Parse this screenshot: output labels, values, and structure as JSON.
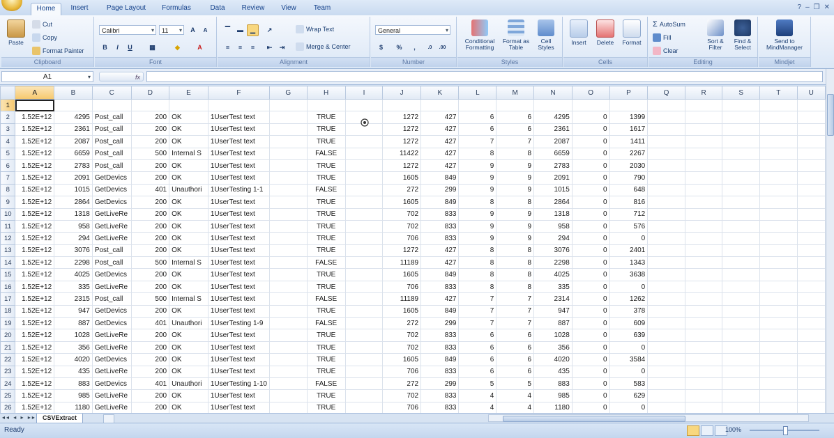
{
  "ribbon": {
    "tabs": [
      "Home",
      "Insert",
      "Page Layout",
      "Formulas",
      "Data",
      "Review",
      "View",
      "Team"
    ],
    "active_tab": "Home",
    "clipboard": {
      "paste": "Paste",
      "cut": "Cut",
      "copy": "Copy",
      "format_painter": "Format Painter",
      "label": "Clipboard"
    },
    "font": {
      "name": "Calibri",
      "size": "11",
      "bold": "B",
      "italic": "I",
      "underline": "U",
      "label": "Font"
    },
    "alignment": {
      "wrap_text": "Wrap Text",
      "merge_center": "Merge & Center",
      "label": "Alignment"
    },
    "number": {
      "format": "General",
      "currency": "$",
      "percent": "%",
      "comma": ",",
      "label": "Number"
    },
    "styles": {
      "conditional": "Conditional Formatting",
      "format_table": "Format as Table",
      "cell_styles": "Cell Styles",
      "label": "Styles"
    },
    "cells": {
      "insert": "Insert",
      "delete": "Delete",
      "format": "Format",
      "label": "Cells"
    },
    "editing": {
      "autosum": "AutoSum",
      "fill": "Fill",
      "clear": "Clear",
      "sort_filter": "Sort & Filter",
      "find_select": "Find & Select",
      "label": "Editing"
    },
    "mindjet": {
      "send": "Send to MindManager",
      "label": "Mindjet"
    }
  },
  "formula_bar": {
    "name_box": "A1",
    "fx": "fx",
    "value": ""
  },
  "grid": {
    "columns": [
      "A",
      "B",
      "C",
      "D",
      "E",
      "F",
      "G",
      "H",
      "I",
      "J",
      "K",
      "L",
      "M",
      "N",
      "O",
      "P",
      "Q",
      "R",
      "S",
      "T",
      "U"
    ],
    "rows": [
      {
        "n": "1",
        "c": [
          "",
          "",
          "",
          "",
          "",
          "",
          "",
          "",
          "",
          "",
          "",
          "",
          "",
          "",
          "",
          ""
        ]
      },
      {
        "n": "2",
        "c": [
          "1.52E+12",
          "4295",
          "Post_call",
          "200",
          "OK",
          "1UserTest text",
          "",
          "TRUE",
          "",
          "1272",
          "427",
          "6",
          "6",
          "4295",
          "0",
          "1399"
        ]
      },
      {
        "n": "3",
        "c": [
          "1.52E+12",
          "2361",
          "Post_call",
          "200",
          "OK",
          "1UserTest text",
          "",
          "TRUE",
          "",
          "1272",
          "427",
          "6",
          "6",
          "2361",
          "0",
          "1617"
        ]
      },
      {
        "n": "4",
        "c": [
          "1.52E+12",
          "2087",
          "Post_call",
          "200",
          "OK",
          "1UserTest text",
          "",
          "TRUE",
          "",
          "1272",
          "427",
          "7",
          "7",
          "2087",
          "0",
          "1411"
        ]
      },
      {
        "n": "5",
        "c": [
          "1.52E+12",
          "6659",
          "Post_call",
          "500",
          "Internal S",
          "1UserTest text",
          "",
          "FALSE",
          "",
          "11422",
          "427",
          "8",
          "8",
          "6659",
          "0",
          "2267"
        ]
      },
      {
        "n": "6",
        "c": [
          "1.52E+12",
          "2783",
          "Post_call",
          "200",
          "OK",
          "1UserTest text",
          "",
          "TRUE",
          "",
          "1272",
          "427",
          "9",
          "9",
          "2783",
          "0",
          "2030"
        ]
      },
      {
        "n": "7",
        "c": [
          "1.52E+12",
          "2091",
          "GetDevics",
          "200",
          "OK",
          "1UserTest text",
          "",
          "TRUE",
          "",
          "1605",
          "849",
          "9",
          "9",
          "2091",
          "0",
          "790"
        ]
      },
      {
        "n": "8",
        "c": [
          "1.52E+12",
          "1015",
          "GetDevics",
          "401",
          "Unauthori",
          "1UserTesting 1-1",
          "",
          "FALSE",
          "",
          "272",
          "299",
          "9",
          "9",
          "1015",
          "0",
          "648"
        ]
      },
      {
        "n": "9",
        "c": [
          "1.52E+12",
          "2864",
          "GetDevics",
          "200",
          "OK",
          "1UserTest text",
          "",
          "TRUE",
          "",
          "1605",
          "849",
          "8",
          "8",
          "2864",
          "0",
          "816"
        ]
      },
      {
        "n": "10",
        "c": [
          "1.52E+12",
          "1318",
          "GetLiveRe",
          "200",
          "OK",
          "1UserTest text",
          "",
          "TRUE",
          "",
          "702",
          "833",
          "9",
          "9",
          "1318",
          "0",
          "712"
        ]
      },
      {
        "n": "11",
        "c": [
          "1.52E+12",
          "958",
          "GetLiveRe",
          "200",
          "OK",
          "1UserTest text",
          "",
          "TRUE",
          "",
          "702",
          "833",
          "9",
          "9",
          "958",
          "0",
          "576"
        ]
      },
      {
        "n": "12",
        "c": [
          "1.52E+12",
          "294",
          "GetLiveRe",
          "200",
          "OK",
          "1UserTest text",
          "",
          "TRUE",
          "",
          "706",
          "833",
          "9",
          "9",
          "294",
          "0",
          "0"
        ]
      },
      {
        "n": "13",
        "c": [
          "1.52E+12",
          "3076",
          "Post_call",
          "200",
          "OK",
          "1UserTest text",
          "",
          "TRUE",
          "",
          "1272",
          "427",
          "8",
          "8",
          "3076",
          "0",
          "2401"
        ]
      },
      {
        "n": "14",
        "c": [
          "1.52E+12",
          "2298",
          "Post_call",
          "500",
          "Internal S",
          "1UserTest text",
          "",
          "FALSE",
          "",
          "11189",
          "427",
          "8",
          "8",
          "2298",
          "0",
          "1343"
        ]
      },
      {
        "n": "15",
        "c": [
          "1.52E+12",
          "4025",
          "GetDevics",
          "200",
          "OK",
          "1UserTest text",
          "",
          "TRUE",
          "",
          "1605",
          "849",
          "8",
          "8",
          "4025",
          "0",
          "3638"
        ]
      },
      {
        "n": "16",
        "c": [
          "1.52E+12",
          "335",
          "GetLiveRe",
          "200",
          "OK",
          "1UserTest text",
          "",
          "TRUE",
          "",
          "706",
          "833",
          "8",
          "8",
          "335",
          "0",
          "0"
        ]
      },
      {
        "n": "17",
        "c": [
          "1.52E+12",
          "2315",
          "Post_call",
          "500",
          "Internal S",
          "1UserTest text",
          "",
          "FALSE",
          "",
          "11189",
          "427",
          "7",
          "7",
          "2314",
          "0",
          "1262"
        ]
      },
      {
        "n": "18",
        "c": [
          "1.52E+12",
          "947",
          "GetDevics",
          "200",
          "OK",
          "1UserTest text",
          "",
          "TRUE",
          "",
          "1605",
          "849",
          "7",
          "7",
          "947",
          "0",
          "378"
        ]
      },
      {
        "n": "19",
        "c": [
          "1.52E+12",
          "887",
          "GetDevics",
          "401",
          "Unauthori",
          "1UserTesting 1-9",
          "",
          "FALSE",
          "",
          "272",
          "299",
          "7",
          "7",
          "887",
          "0",
          "609"
        ]
      },
      {
        "n": "20",
        "c": [
          "1.52E+12",
          "1028",
          "GetLiveRe",
          "200",
          "OK",
          "1UserTest text",
          "",
          "TRUE",
          "",
          "702",
          "833",
          "6",
          "6",
          "1028",
          "0",
          "639"
        ]
      },
      {
        "n": "21",
        "c": [
          "1.52E+12",
          "356",
          "GetLiveRe",
          "200",
          "OK",
          "1UserTest text",
          "",
          "TRUE",
          "",
          "702",
          "833",
          "6",
          "6",
          "356",
          "0",
          "0"
        ]
      },
      {
        "n": "22",
        "c": [
          "1.52E+12",
          "4020",
          "GetDevics",
          "200",
          "OK",
          "1UserTest text",
          "",
          "TRUE",
          "",
          "1605",
          "849",
          "6",
          "6",
          "4020",
          "0",
          "3584"
        ]
      },
      {
        "n": "23",
        "c": [
          "1.52E+12",
          "435",
          "GetLiveRe",
          "200",
          "OK",
          "1UserTest text",
          "",
          "TRUE",
          "",
          "706",
          "833",
          "6",
          "6",
          "435",
          "0",
          "0"
        ]
      },
      {
        "n": "24",
        "c": [
          "1.52E+12",
          "883",
          "GetDevics",
          "401",
          "Unauthori",
          "1UserTesting 1-10",
          "",
          "FALSE",
          "",
          "272",
          "299",
          "5",
          "5",
          "883",
          "0",
          "583"
        ]
      },
      {
        "n": "25",
        "c": [
          "1.52E+12",
          "985",
          "GetLiveRe",
          "200",
          "OK",
          "1UserTest text",
          "",
          "TRUE",
          "",
          "702",
          "833",
          "4",
          "4",
          "985",
          "0",
          "629"
        ]
      },
      {
        "n": "26",
        "c": [
          "1.52E+12",
          "1180",
          "GetLiveRe",
          "200",
          "OK",
          "1UserTest text",
          "",
          "TRUE",
          "",
          "706",
          "833",
          "4",
          "4",
          "1180",
          "0",
          "0"
        ]
      }
    ]
  },
  "sheet_tabs": {
    "nav": "◂◂ ◂ ▸ ▸▸",
    "active": "CSVExtract"
  },
  "status": {
    "text": "Ready",
    "zoom": "100%"
  }
}
